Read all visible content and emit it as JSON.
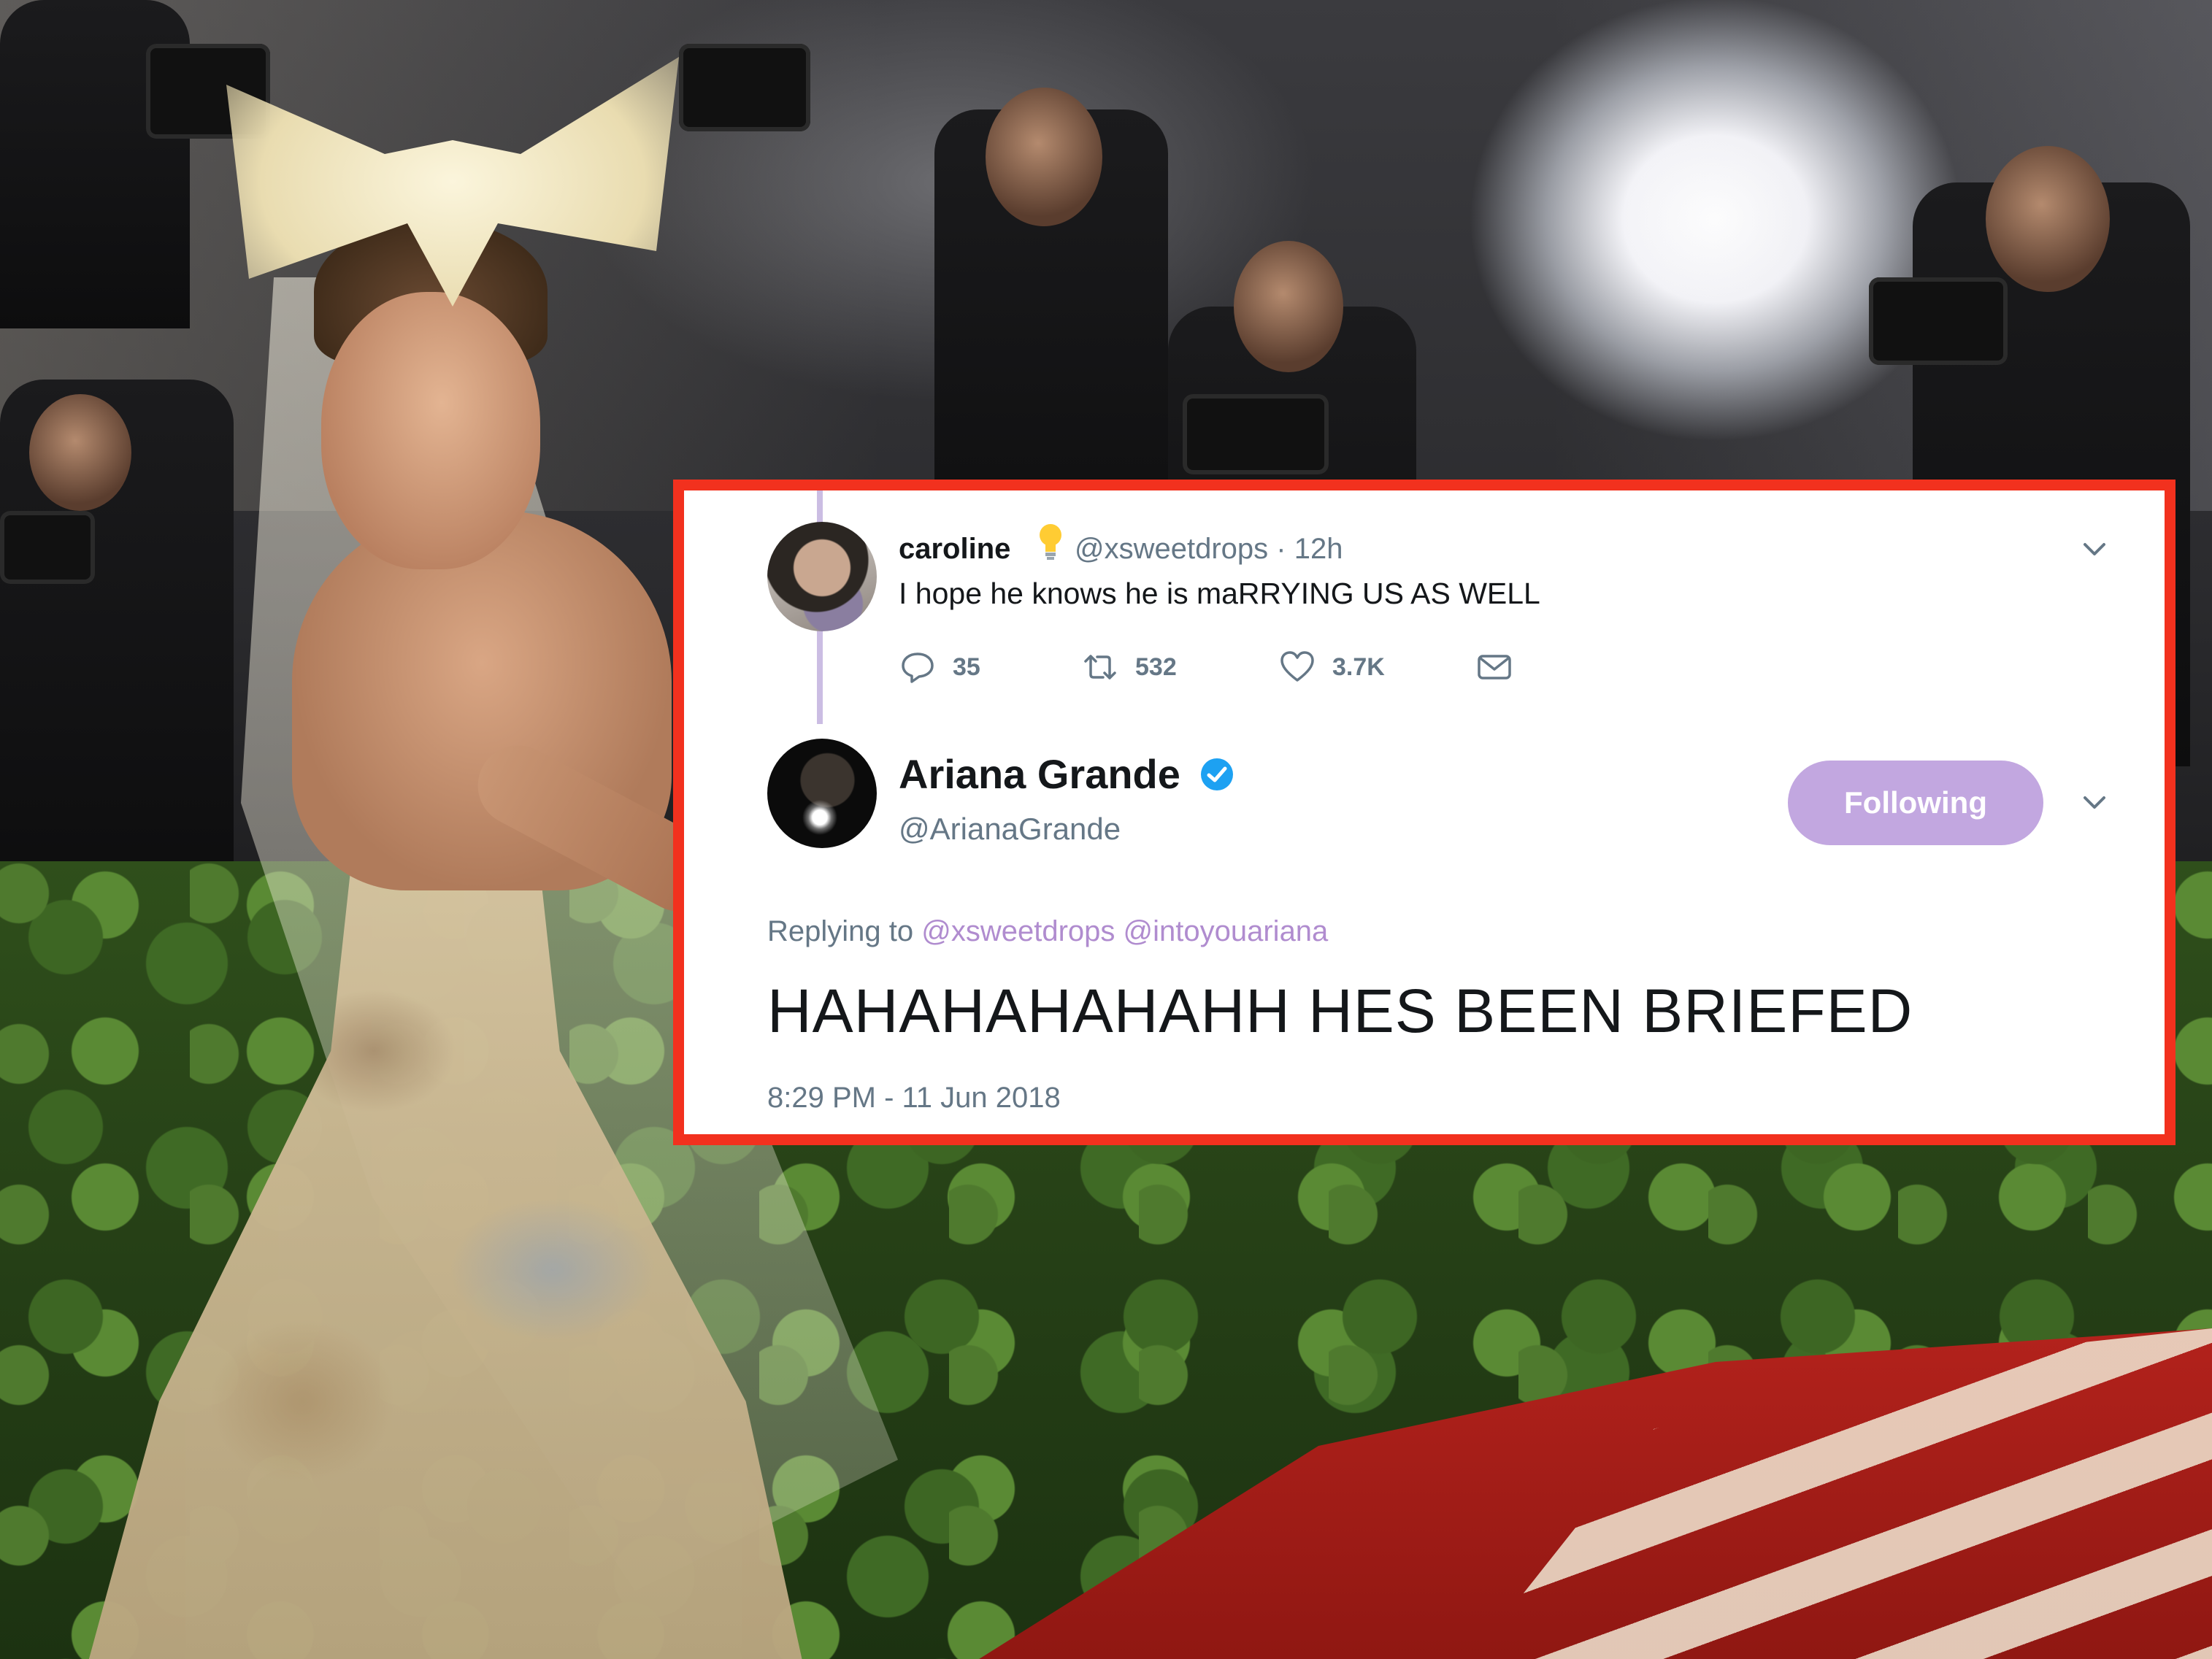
{
  "tweet_thread": {
    "parent": {
      "display_name": "caroline",
      "badge_icon": "lightbulb-emoji",
      "handle_and_time": "@xsweetdrops · 12h",
      "text": "I hope he knows he is maRRYING US AS WELL",
      "reply_count": "35",
      "retweet_count": "532",
      "like_count": "3.7K"
    },
    "reply": {
      "display_name": "Ariana Grande",
      "handle": "@ArianaGrande",
      "follow_button_label": "Following",
      "replying_to_prefix": "Replying to",
      "replying_to_mentions": "@xsweetdrops @intoyouariana",
      "text": "HAHAHAHAHAHH HES BEEN BRIEFED",
      "timestamp": "8:29 PM - 11 Jun 2018"
    }
  },
  "colors": {
    "highlight_border": "#f2311e",
    "follow_button": "#c2a7e0",
    "mention": "#b08ccf",
    "verified": "#1da1f2"
  }
}
